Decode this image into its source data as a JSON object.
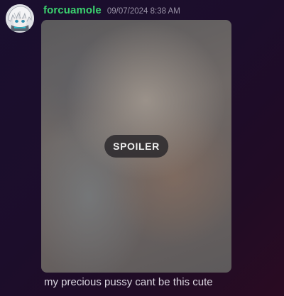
{
  "message": {
    "author": "forcuamole",
    "timestamp": "09/07/2024 8:38 AM",
    "content": "my precious pussy cant be this cute",
    "attachment": {
      "spoiler_label": "SPOILER",
      "spoiler": true
    }
  },
  "colors": {
    "username": "#3bd16f",
    "timestamp": "#9a93a6",
    "message_text": "#dcd8e2"
  }
}
